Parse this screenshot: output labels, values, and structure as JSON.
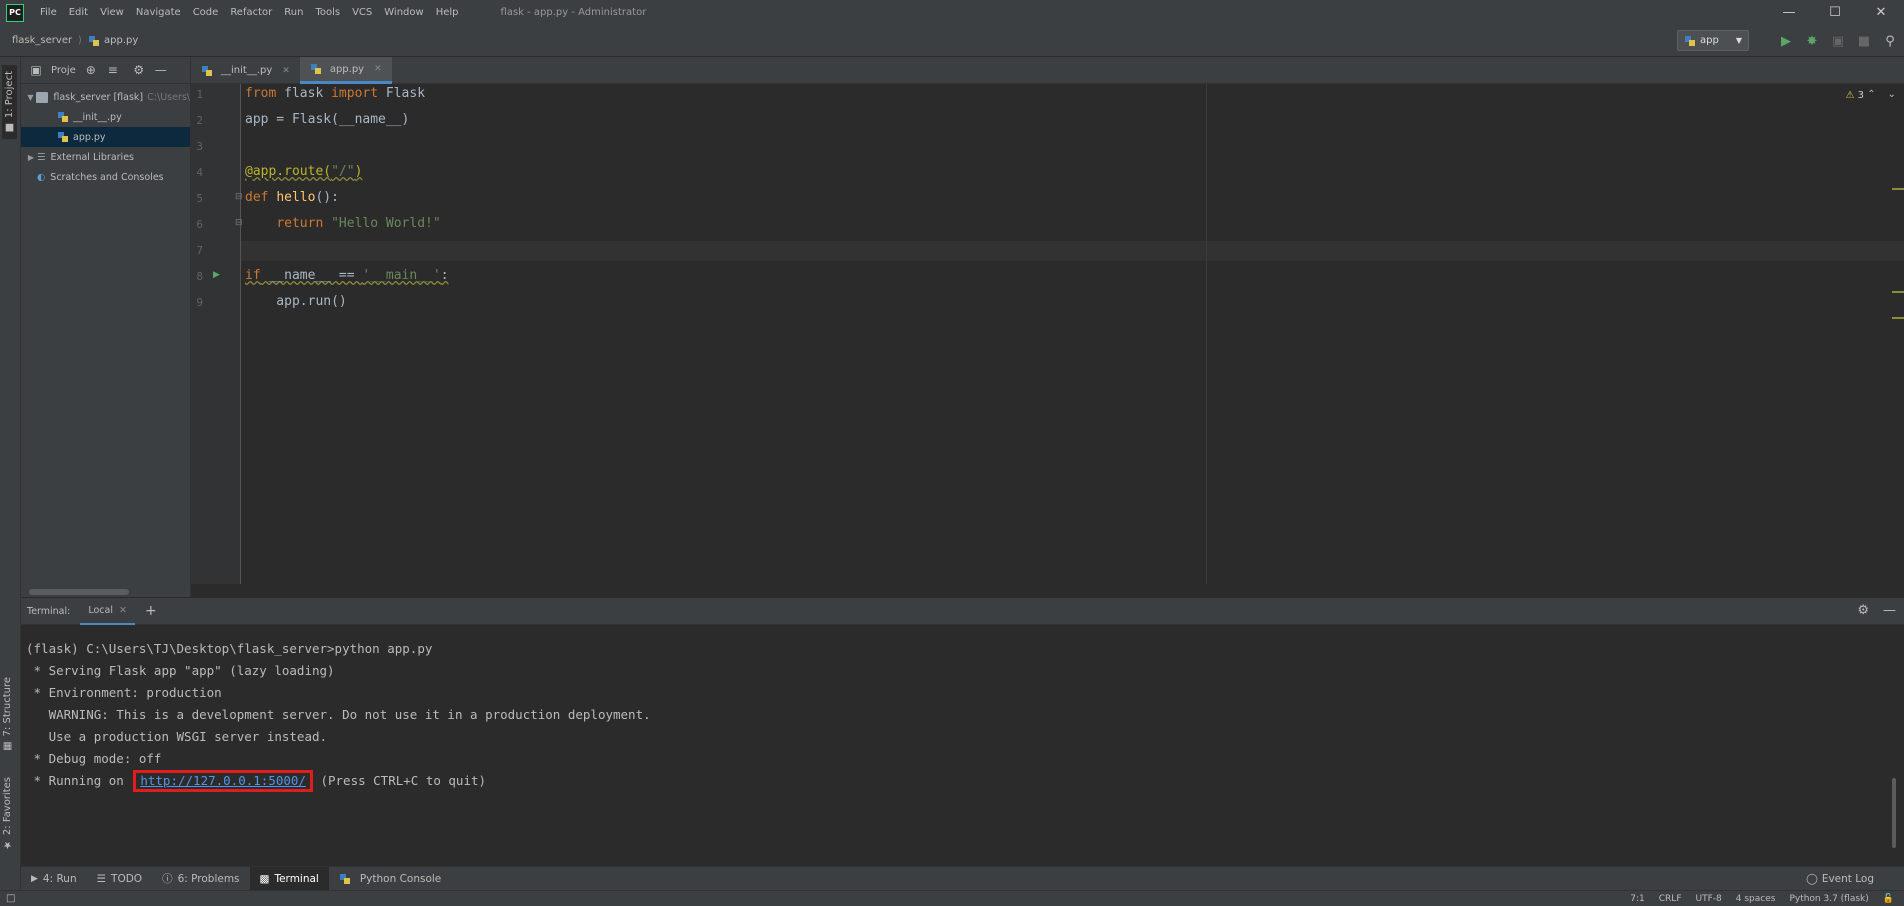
{
  "window": {
    "logo": "PC",
    "title": "flask - app.py - Administrator"
  },
  "menu": [
    "File",
    "Edit",
    "View",
    "Navigate",
    "Code",
    "Refactor",
    "Run",
    "Tools",
    "VCS",
    "Window",
    "Help"
  ],
  "breadcrumb": {
    "project": "flask_server",
    "file": "app.py"
  },
  "run_config": {
    "label": "app"
  },
  "left_tabs": {
    "project": "1: Project",
    "structure": "7: Structure",
    "favorites": "2: Favorites"
  },
  "project_panel": {
    "title": "Proje",
    "tree": [
      {
        "label": "flask_server [flask]",
        "extra": "C:\\Users\\"
      },
      {
        "label": "__init__.py"
      },
      {
        "label": "app.py"
      },
      {
        "label": "External Libraries"
      },
      {
        "label": "Scratches and Consoles"
      }
    ]
  },
  "editor_tabs": [
    {
      "label": "__init__.py"
    },
    {
      "label": "app.py"
    }
  ],
  "editor": {
    "warnings": "3",
    "line_numbers": [
      "1",
      "2",
      "3",
      "4",
      "5",
      "6",
      "7",
      "8",
      "9"
    ]
  },
  "terminal": {
    "label": "Terminal:",
    "tab": "Local",
    "lines": [
      "(flask) C:\\Users\\TJ\\Desktop\\flask_server>python app.py",
      " * Serving Flask app \"app\" (lazy loading)",
      " * Environment: production",
      "   WARNING: This is a development server. Do not use it in a production deployment.",
      "   Use a production WSGI server instead.",
      " * Debug mode: off"
    ],
    "running_prefix": " * Running on ",
    "running_url": "http://127.0.0.1:5000/",
    "running_suffix": " (Press CTRL+C to quit)"
  },
  "bottom_tools": {
    "run": "4: Run",
    "todo": "TODO",
    "problems": "6: Problems",
    "terminal": "Terminal",
    "python_console": "Python Console",
    "event_log": "Event Log"
  },
  "status": {
    "position": "7:1",
    "line_sep": "CRLF",
    "encoding": "UTF-8",
    "indent": "4 spaces",
    "interpreter": "Python 3.7 (flask)"
  }
}
